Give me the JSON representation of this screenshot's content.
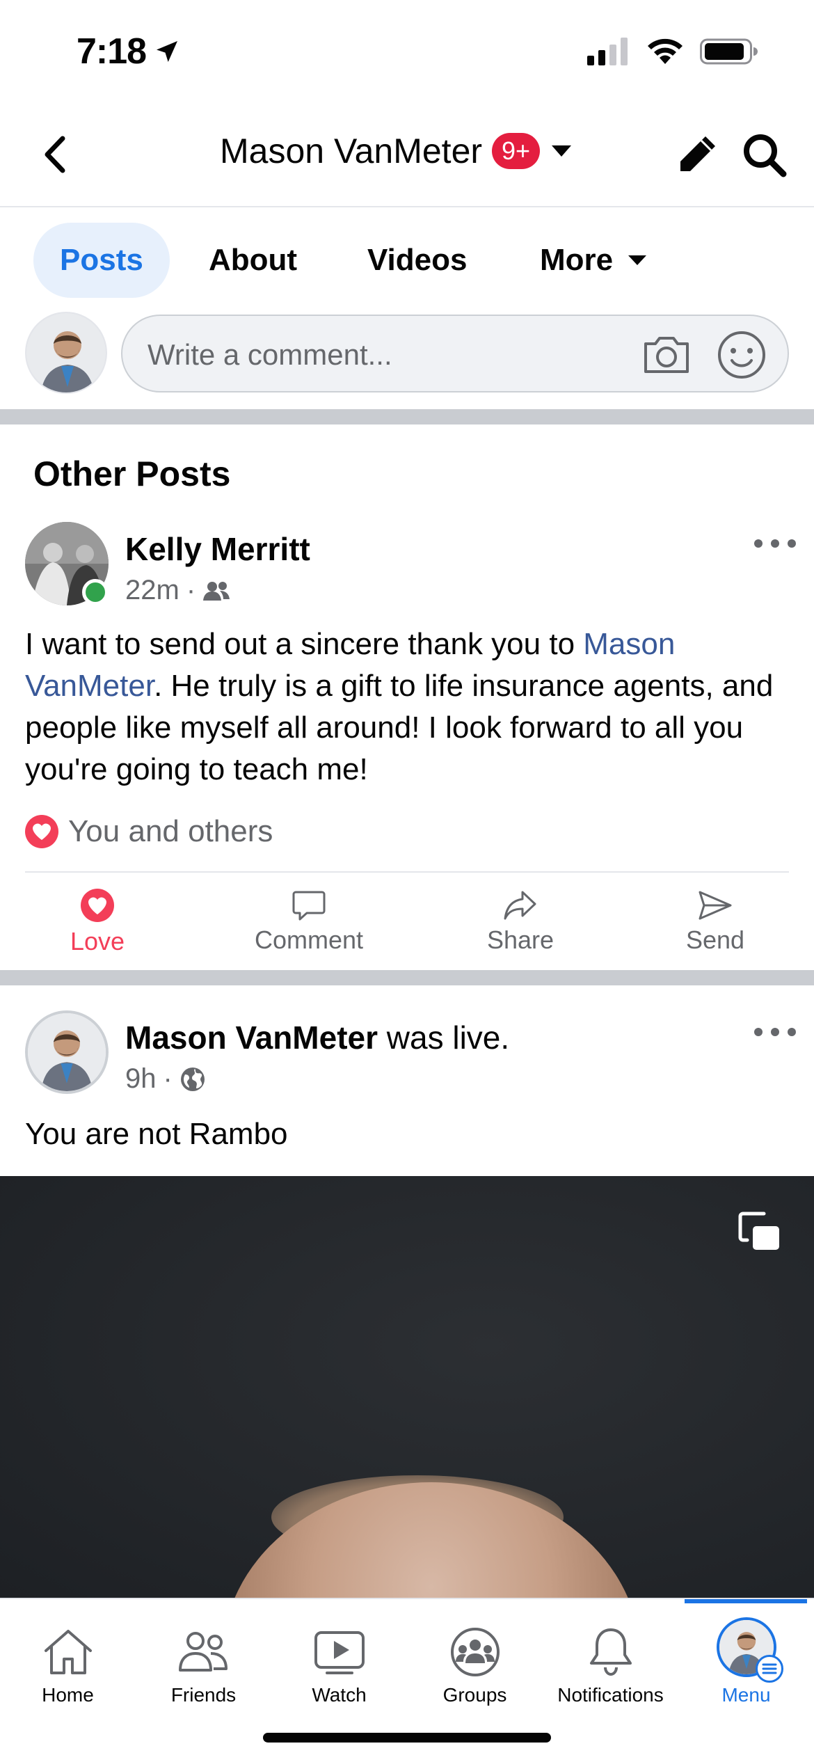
{
  "status_bar": {
    "time": "7:18",
    "icons": [
      "location-arrow-icon",
      "cellular-signal-icon",
      "wifi-icon",
      "battery-icon"
    ]
  },
  "header": {
    "title": "Mason VanMeter",
    "notification_badge": "9+",
    "badge_color": "#e41e3f"
  },
  "tabs": [
    {
      "label": "Posts",
      "active": true
    },
    {
      "label": "About",
      "active": false
    },
    {
      "label": "Videos",
      "active": false
    },
    {
      "label": "More",
      "active": false
    }
  ],
  "composer": {
    "placeholder": "Write a comment..."
  },
  "section_title": "Other Posts",
  "post1": {
    "author": "Kelly Merritt",
    "time": "22m",
    "audience_icon": "friends-icon",
    "online": true,
    "text_before": "I want to send out a sincere thank you to ",
    "mention": "Mason VanMeter",
    "text_after": ". He truly is a gift to life insurance agents, and people like myself all around! I look forward to all you you're going to teach me!",
    "reactions_text": "You and others",
    "actions": {
      "love": "Love",
      "comment": "Comment",
      "share": "Share",
      "send": "Send"
    }
  },
  "post2": {
    "author": "Mason VanMeter",
    "suffix": " was live.",
    "time": "9h",
    "audience_icon": "globe-icon",
    "text": "You are not Rambo"
  },
  "bottom_nav": [
    {
      "label": "Home",
      "icon": "home-icon",
      "active": false
    },
    {
      "label": "Friends",
      "icon": "friends-icon",
      "active": false
    },
    {
      "label": "Watch",
      "icon": "watch-icon",
      "active": false
    },
    {
      "label": "Groups",
      "icon": "groups-icon",
      "active": false
    },
    {
      "label": "Notifications",
      "icon": "bell-icon",
      "active": false
    },
    {
      "label": "Menu",
      "icon": "avatar-menu-icon",
      "active": true
    }
  ],
  "colors": {
    "accent": "#1b74e4",
    "love": "#f33e58",
    "online": "#31a24c",
    "muted_text": "#65676b"
  }
}
